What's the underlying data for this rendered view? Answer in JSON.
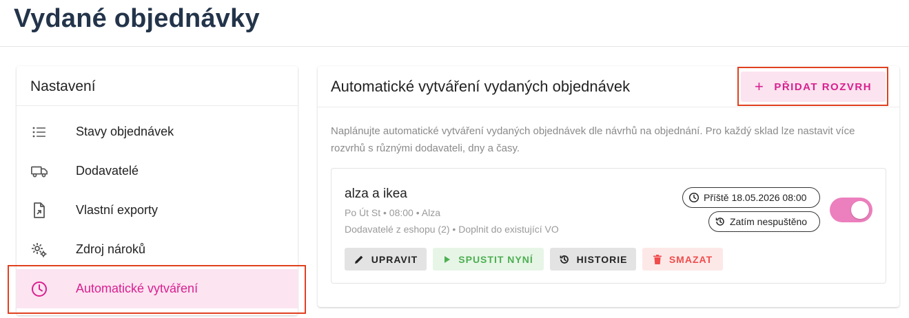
{
  "page": {
    "title": "Vydané objednávky"
  },
  "sidebar": {
    "title": "Nastavení",
    "items": [
      {
        "label": "Stavy objednávek",
        "icon": "list-icon"
      },
      {
        "label": "Dodavatelé",
        "icon": "truck-icon"
      },
      {
        "label": "Vlastní exporty",
        "icon": "file-export-icon"
      },
      {
        "label": "Zdroj nároků",
        "icon": "gears-icon"
      },
      {
        "label": "Automatické vytváření",
        "icon": "clock-icon",
        "active": true
      }
    ]
  },
  "main": {
    "title": "Automatické vytváření vydaných objednávek",
    "add_button": "PŘIDAT ROZVRH",
    "description": "Naplánujte automatické vytváření vydaných objednávek dle návrhů na objednání. Pro každý sklad lze nastavit více rozvrhů s různými dodavateli, dny a časy.",
    "schedule": {
      "name": "alza a ikea",
      "meta_line1": "Po Út St • 08:00 • Alza",
      "meta_line2": "Dodavatelé z eshopu (2) • Doplnit do existující VO",
      "next_run": "Příště 18.05.2026 08:00",
      "status": "Zatím nespuštěno",
      "enabled": true,
      "actions": {
        "edit": "UPRAVIT",
        "run": "SPUSTIT NYNÍ",
        "history": "HISTORIE",
        "delete": "SMAZAT"
      }
    }
  },
  "colors": {
    "accent": "#d8208f",
    "accent_bg": "#fce4f1",
    "toggle_on": "#ec7fbd",
    "highlight_box": "#e0401f",
    "title_dark": "#23344a",
    "run_green": "#4caf50",
    "delete_red": "#f04c4c"
  }
}
